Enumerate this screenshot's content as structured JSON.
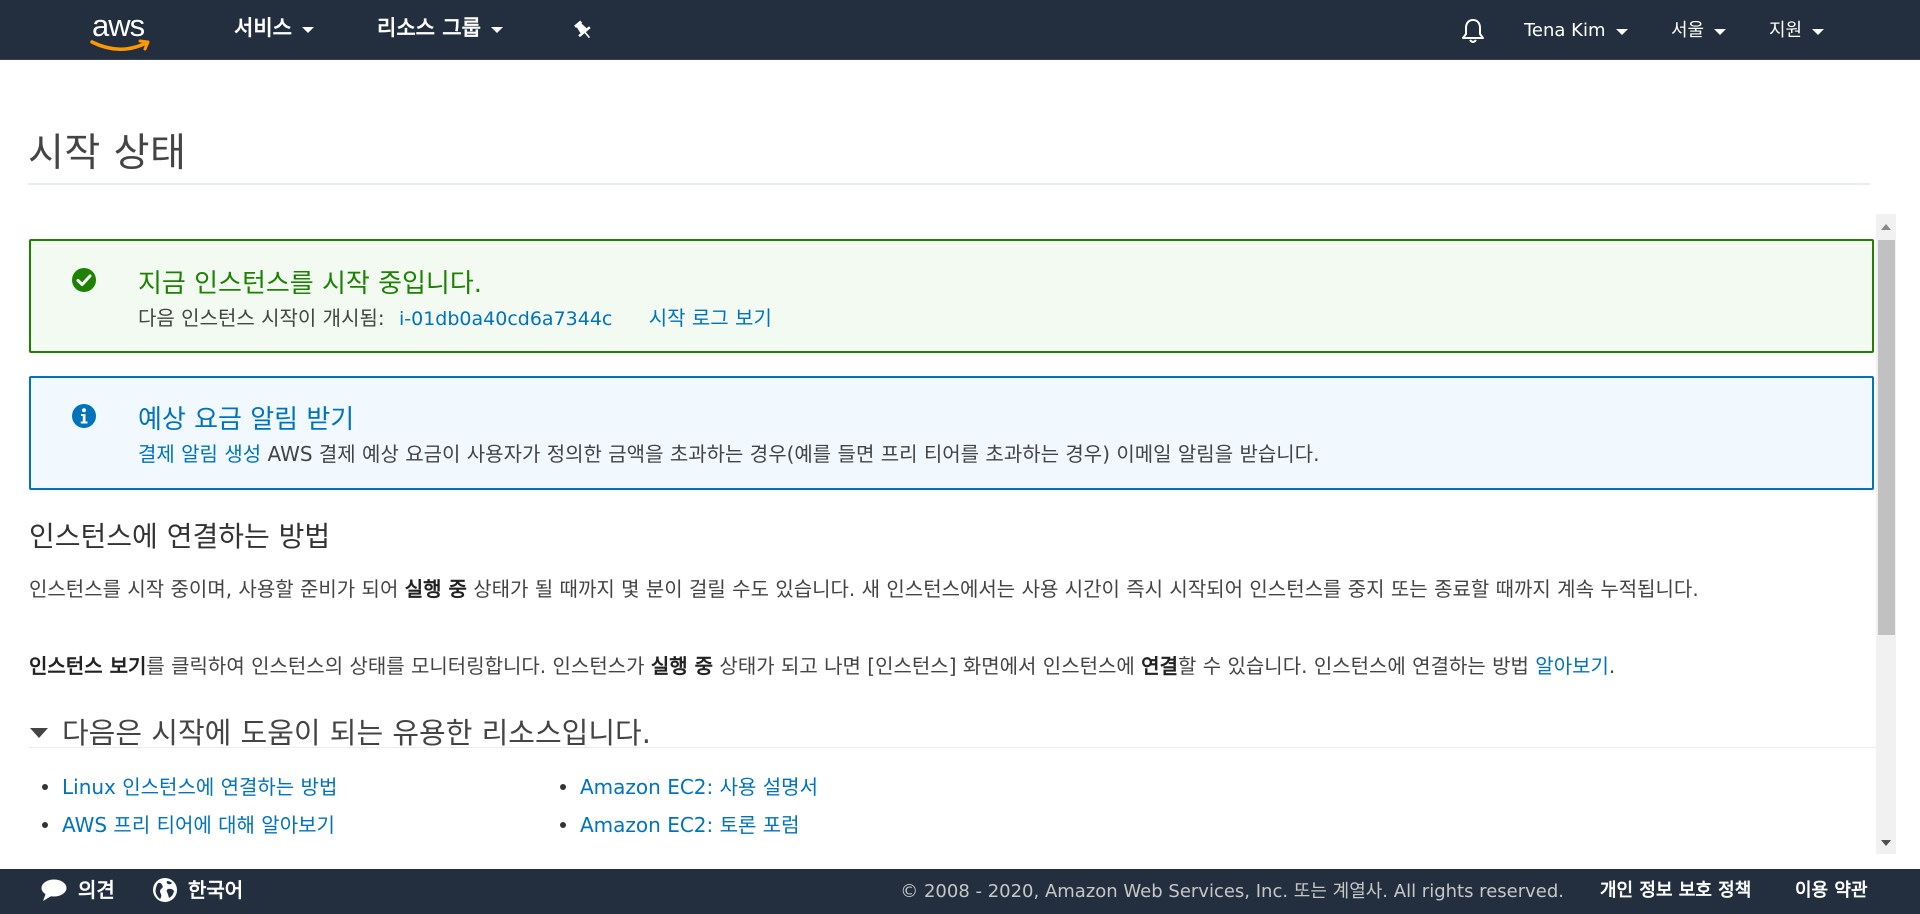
{
  "nav": {
    "logo_text": "aws",
    "services_label": "서비스",
    "resource_groups_label": "리소스 그룹",
    "user_label": "Tena Kim",
    "region_label": "서울",
    "support_label": "지원"
  },
  "page": {
    "title": "시작 상태"
  },
  "success_alert": {
    "heading": "지금 인스턴스를 시작 중입니다.",
    "text": "다음 인스턴스 시작이 개시됨:",
    "instance_id": "i-01db0a40cd6a7344c",
    "log_link": "시작 로그 보기"
  },
  "info_alert": {
    "heading": "예상 요금 알림 받기",
    "link": "결제 알림 생성",
    "text": " AWS 결제 예상 요금이 사용자가 정의한 금액을 초과하는 경우(예를 들면 프리 티어를 초과하는 경우) 이메일 알림을 받습니다."
  },
  "connect": {
    "heading": "인스턴스에 연결하는 방법",
    "p1_a": "인스턴스를 시작 중이며, 사용할 준비가 되어 ",
    "p1_bold": "실행 중",
    "p1_b": " 상태가 될 때까지 몇 분이 걸릴 수도 있습니다. 새 인스턴스에서는 사용 시간이 즉시 시작되어 인스턴스를 중지 또는 종료할 때까지 계속 누적됩니다.",
    "p2_bold1": "인스턴스 보기",
    "p2_a": "를 클릭하여 인스턴스의 상태를 모니터링합니다. 인스턴스가 ",
    "p2_bold2": "실행 중",
    "p2_b": " 상태가 되고 나면 [인스턴스] 화면에서 인스턴스에 ",
    "p2_bold3": "연결",
    "p2_c": "할 수 있습니다. 인스턴스에 연결하는 방법 ",
    "p2_link": "알아보기",
    "p2_end": "."
  },
  "resources": {
    "heading": "다음은 시작에 도움이 되는 유용한 리소스입니다.",
    "left_links": [
      "Linux 인스턴스에 연결하는 방법",
      "AWS 프리 티어에 대해 알아보기"
    ],
    "right_links": [
      "Amazon EC2: 사용 설명서",
      "Amazon EC2: 토론 포럼"
    ]
  },
  "footer": {
    "feedback_label": "의견",
    "language_label": "한국어",
    "copyright": "© 2008 - 2020, Amazon Web Services, Inc. 또는 계열사. All rights reserved.",
    "privacy_label": "개인 정보 보호 정책",
    "terms_label": "이용 약관"
  },
  "colors": {
    "nav_bg": "#232f3e",
    "success": "#1d8102",
    "info": "#0073bb",
    "link": "#0073bb"
  }
}
